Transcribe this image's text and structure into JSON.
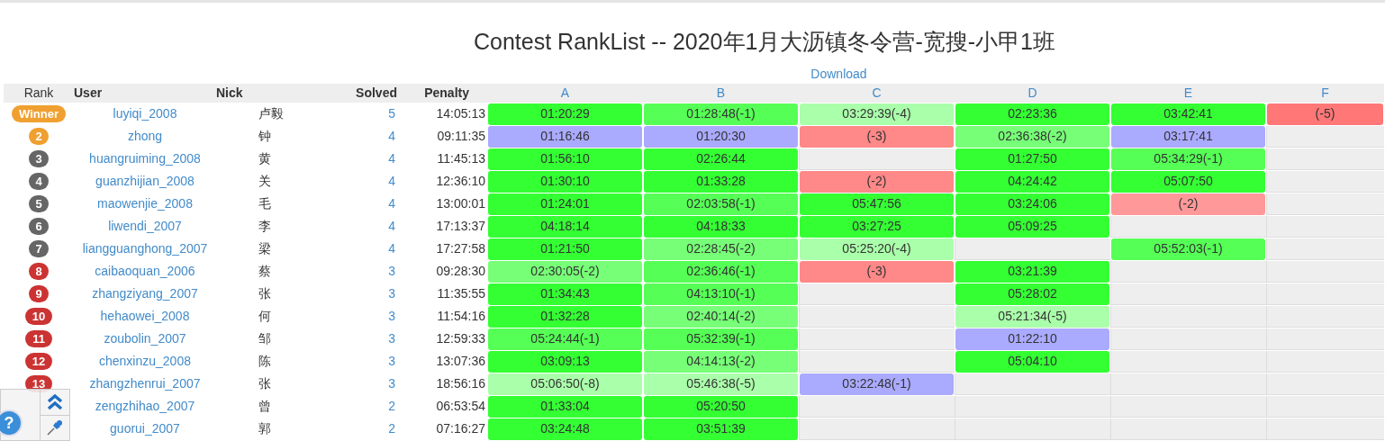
{
  "title": "Contest RankList -- 2020年1月大沥镇冬令营-宽搜-小甲1班",
  "download": "Download",
  "columns": [
    "Rank",
    "User",
    "Nick",
    "Solved",
    "Penalty"
  ],
  "problems": [
    "A",
    "B",
    "C",
    "D",
    "E",
    "F"
  ],
  "rows": [
    {
      "rank": {
        "text": "Winner",
        "color": "#f0a030"
      },
      "user": "luyiqi_2008",
      "nick": "卢毅",
      "solved": "5",
      "penalty": "14:05:13",
      "cells": [
        {
          "text": "01:20:29",
          "color": "#33ff33"
        },
        {
          "text": "01:28:48(-1)",
          "color": "#55ff55"
        },
        {
          "text": "03:29:39(-4)",
          "color": "#aaffaa"
        },
        {
          "text": "02:23:36",
          "color": "#33ff33"
        },
        {
          "text": "03:42:41",
          "color": "#33ff33"
        },
        {
          "text": "(-5)",
          "color": "#ff7777"
        }
      ]
    },
    {
      "rank": {
        "text": "2",
        "color": "#f0a030"
      },
      "user": "zhong",
      "nick": "钟",
      "solved": "4",
      "penalty": "09:11:35",
      "cells": [
        {
          "text": "01:16:46",
          "color": "#aaaaff"
        },
        {
          "text": "01:20:30",
          "color": "#aaaaff"
        },
        {
          "text": "(-3)",
          "color": "#ff8888"
        },
        {
          "text": "02:36:38(-2)",
          "color": "#77ff77"
        },
        {
          "text": "03:17:41",
          "color": "#aaaaff"
        },
        null
      ]
    },
    {
      "rank": {
        "text": "3",
        "color": "#666666"
      },
      "user": "huangruiming_2008",
      "nick": "黄",
      "solved": "4",
      "penalty": "11:45:13",
      "cells": [
        {
          "text": "01:56:10",
          "color": "#33ff33"
        },
        {
          "text": "02:26:44",
          "color": "#33ff33"
        },
        null,
        {
          "text": "01:27:50",
          "color": "#33ff33"
        },
        {
          "text": "05:34:29(-1)",
          "color": "#55ff55"
        },
        null
      ]
    },
    {
      "rank": {
        "text": "4",
        "color": "#666666"
      },
      "user": "guanzhijian_2008",
      "nick": "关",
      "solved": "4",
      "penalty": "12:36:10",
      "cells": [
        {
          "text": "01:30:10",
          "color": "#33ff33"
        },
        {
          "text": "01:33:28",
          "color": "#33ff33"
        },
        {
          "text": "(-2)",
          "color": "#ff8888"
        },
        {
          "text": "04:24:42",
          "color": "#33ff33"
        },
        {
          "text": "05:07:50",
          "color": "#33ff33"
        },
        null
      ]
    },
    {
      "rank": {
        "text": "5",
        "color": "#666666"
      },
      "user": "maowenjie_2008",
      "nick": "毛",
      "solved": "4",
      "penalty": "13:00:01",
      "cells": [
        {
          "text": "01:24:01",
          "color": "#33ff33"
        },
        {
          "text": "02:03:58(-1)",
          "color": "#55ff55"
        },
        {
          "text": "05:47:56",
          "color": "#33ff33"
        },
        {
          "text": "03:24:06",
          "color": "#33ff33"
        },
        {
          "text": "(-2)",
          "color": "#ff9999"
        },
        null
      ]
    },
    {
      "rank": {
        "text": "6",
        "color": "#666666"
      },
      "user": "liwendi_2007",
      "nick": "李",
      "solved": "4",
      "penalty": "17:13:37",
      "cells": [
        {
          "text": "04:18:14",
          "color": "#33ff33"
        },
        {
          "text": "04:18:33",
          "color": "#33ff33"
        },
        {
          "text": "03:27:25",
          "color": "#33ff33"
        },
        {
          "text": "05:09:25",
          "color": "#33ff33"
        },
        null,
        null
      ]
    },
    {
      "rank": {
        "text": "7",
        "color": "#666666"
      },
      "user": "liangguanghong_2007",
      "nick": "梁",
      "solved": "4",
      "penalty": "17:27:58",
      "cells": [
        {
          "text": "01:21:50",
          "color": "#33ff33"
        },
        {
          "text": "02:28:45(-2)",
          "color": "#77ff77"
        },
        {
          "text": "05:25:20(-4)",
          "color": "#aaffaa"
        },
        null,
        {
          "text": "05:52:03(-1)",
          "color": "#55ff55"
        },
        null
      ]
    },
    {
      "rank": {
        "text": "8",
        "color": "#cc3333"
      },
      "user": "caibaoquan_2006",
      "nick": "蔡",
      "solved": "3",
      "penalty": "09:28:30",
      "cells": [
        {
          "text": "02:30:05(-2)",
          "color": "#77ff77"
        },
        {
          "text": "02:36:46(-1)",
          "color": "#55ff55"
        },
        {
          "text": "(-3)",
          "color": "#ff8888"
        },
        {
          "text": "03:21:39",
          "color": "#33ff33"
        },
        null,
        null
      ]
    },
    {
      "rank": {
        "text": "9",
        "color": "#cc3333"
      },
      "user": "zhangziyang_2007",
      "nick": "张",
      "solved": "3",
      "penalty": "11:35:55",
      "cells": [
        {
          "text": "01:34:43",
          "color": "#33ff33"
        },
        {
          "text": "04:13:10(-1)",
          "color": "#55ff55"
        },
        null,
        {
          "text": "05:28:02",
          "color": "#33ff33"
        },
        null,
        null
      ]
    },
    {
      "rank": {
        "text": "10",
        "color": "#cc3333"
      },
      "user": "hehaowei_2008",
      "nick": "何",
      "solved": "3",
      "penalty": "11:54:16",
      "cells": [
        {
          "text": "01:32:28",
          "color": "#33ff33"
        },
        {
          "text": "02:40:14(-2)",
          "color": "#77ff77"
        },
        null,
        {
          "text": "05:21:34(-5)",
          "color": "#aaffaa"
        },
        null,
        null
      ]
    },
    {
      "rank": {
        "text": "11",
        "color": "#cc3333"
      },
      "user": "zoubolin_2007",
      "nick": "邹",
      "solved": "3",
      "penalty": "12:59:33",
      "cells": [
        {
          "text": "05:24:44(-1)",
          "color": "#55ff55"
        },
        {
          "text": "05:32:39(-1)",
          "color": "#55ff55"
        },
        null,
        {
          "text": "01:22:10",
          "color": "#aaaaff"
        },
        null,
        null
      ]
    },
    {
      "rank": {
        "text": "12",
        "color": "#cc3333"
      },
      "user": "chenxinzu_2008",
      "nick": "陈",
      "solved": "3",
      "penalty": "13:07:36",
      "cells": [
        {
          "text": "03:09:13",
          "color": "#33ff33"
        },
        {
          "text": "04:14:13(-2)",
          "color": "#77ff77"
        },
        null,
        {
          "text": "05:04:10",
          "color": "#33ff33"
        },
        null,
        null
      ]
    },
    {
      "rank": {
        "text": "13",
        "color": "#cc3333"
      },
      "user": "zhangzhenrui_2007",
      "nick": "张",
      "solved": "3",
      "penalty": "18:56:16",
      "cells": [
        {
          "text": "05:06:50(-8)",
          "color": "#aaffaa"
        },
        {
          "text": "05:46:38(-5)",
          "color": "#aaffaa"
        },
        {
          "text": "03:22:48(-1)",
          "color": "#aaaaff"
        },
        null,
        null,
        null
      ]
    },
    {
      "user": "zengzhihao_2007",
      "nick": "曾",
      "solved": "2",
      "penalty": "06:53:54",
      "cells": [
        {
          "text": "01:33:04",
          "color": "#33ff33"
        },
        {
          "text": "05:20:50",
          "color": "#33ff33"
        },
        null,
        null,
        null,
        null
      ]
    },
    {
      "user": "guorui_2007",
      "nick": "郭",
      "solved": "2",
      "penalty": "07:16:27",
      "cells": [
        {
          "text": "03:24:48",
          "color": "#33ff33"
        },
        {
          "text": "03:51:39",
          "color": "#33ff33"
        },
        null,
        null,
        null,
        null
      ]
    }
  ],
  "help": {
    "label": "?"
  }
}
